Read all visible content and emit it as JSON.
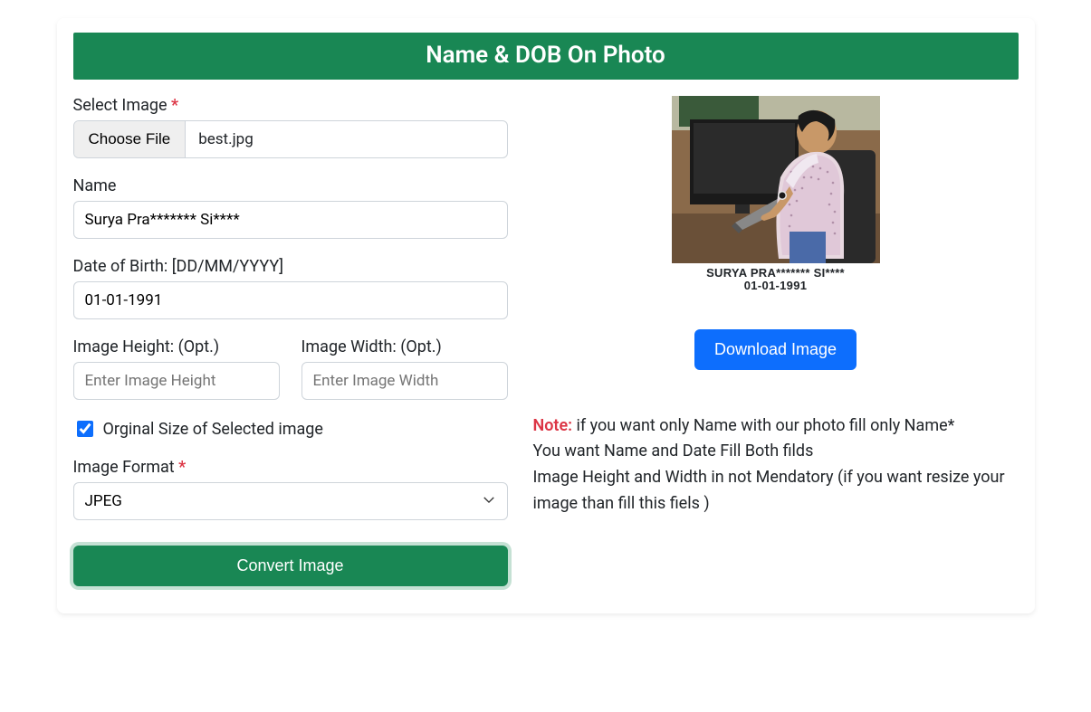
{
  "header": {
    "title": "Name & DOB On Photo"
  },
  "form": {
    "select_image": {
      "label": "Select Image",
      "choose_label": "Choose File",
      "file_name": "best.jpg"
    },
    "name": {
      "label": "Name",
      "value": "Surya Pra******* Si****"
    },
    "dob": {
      "label": "Date of Birth: [DD/MM/YYYY]",
      "value": "01-01-1991"
    },
    "height": {
      "label": "Image Height: (Opt.)",
      "placeholder": "Enter Image Height"
    },
    "width": {
      "label": "Image Width: (Opt.)",
      "placeholder": "Enter Image Width"
    },
    "original_size": {
      "label": "Orginal Size of Selected image",
      "checked": true
    },
    "format": {
      "label": "Image Format",
      "selected": "JPEG"
    },
    "convert_label": "Convert Image"
  },
  "preview": {
    "caption_name": "SURYA PRA******* SI****",
    "caption_date": "01-01-1991",
    "download_label": "Download Image"
  },
  "note": {
    "label": "Note:",
    "line1": "if you want only Name with our photo fill only Name*",
    "line2": "You want Name and Date Fill Both filds",
    "line3": "Image Height and Width in not Mendatory (if you want resize your image than fill this fiels )"
  }
}
